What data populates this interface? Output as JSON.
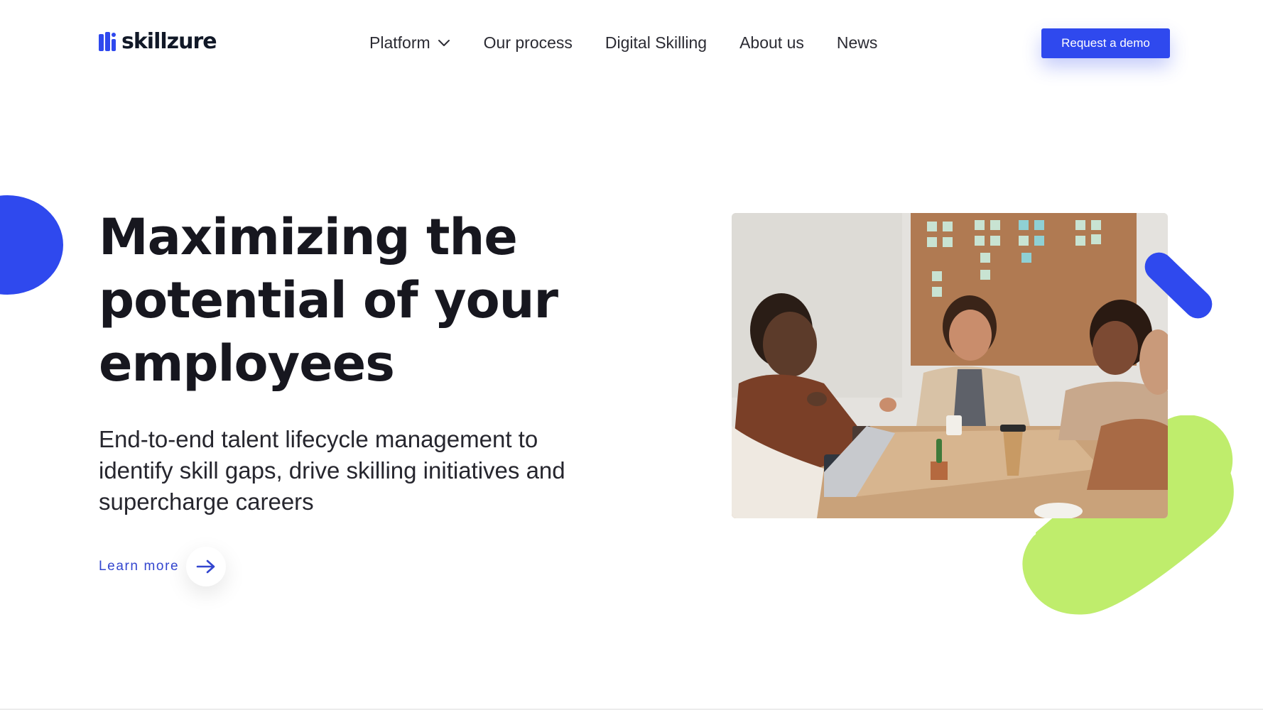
{
  "brand": {
    "name": "skillzure",
    "accent_color": "#2f49ee",
    "green_color": "#bfed6c"
  },
  "nav": {
    "items": [
      {
        "label": "Platform",
        "icon": "chevron-down-icon"
      },
      {
        "label": "Our process"
      },
      {
        "label": "Digital Skilling"
      },
      {
        "label": "About us"
      },
      {
        "label": "News"
      }
    ]
  },
  "header": {
    "cta_label": "Request a demo"
  },
  "hero": {
    "title_lines": [
      "Maximizing the",
      "potential of your",
      "employees"
    ],
    "subtitle_lines": [
      "End-to-end talent lifecycle management to",
      "identify skill gaps, drive skilling initiatives and",
      "supercharge careers"
    ],
    "learn_more_label": "Learn more",
    "learn_more_icon": "arrow-right-icon",
    "image_subject": "team meeting photo"
  }
}
